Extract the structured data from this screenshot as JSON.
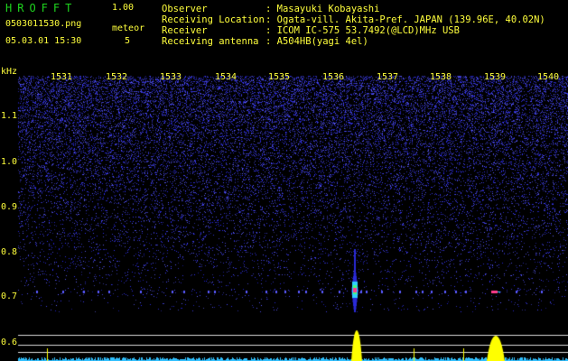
{
  "header": {
    "brand": "HROFFT",
    "version": "1.00",
    "filename": "0503011530.png",
    "datetime": "05.03.01 15:30",
    "meteor_label": "meteor",
    "meteor_count": "5"
  },
  "info": {
    "labels": [
      "Observer",
      "Receiving Location",
      "Receiver",
      "Receiving antenna"
    ],
    "values": [
      ": Masayuki Kobayashi",
      ": Ogata-vill. Akita-Pref. JAPAN (139.96E, 40.02N)",
      ": ICOM IC-575 53.7492(@LCD)MHz USB",
      ": A504HB(yagi 4el)"
    ]
  },
  "axes": {
    "y_unit": "kHz",
    "y_ticks": [
      "1.1",
      "1.0",
      "0.9",
      "0.8",
      "0.7",
      "0.6"
    ],
    "x_ticks": [
      "1531",
      "1532",
      "1533",
      "1534",
      "1535",
      "1536",
      "1537",
      "1538",
      "1539",
      "1540"
    ]
  },
  "colors": {
    "background": "#000000",
    "noise": "#2a2ad8",
    "label": "#ffff3c",
    "brand": "#1ed41e",
    "meteor_core": "#ff3c8c",
    "meteor_halo": "#30d0ff",
    "baseline": "#d8d8d8",
    "signal_peak": "#ffff00"
  }
}
